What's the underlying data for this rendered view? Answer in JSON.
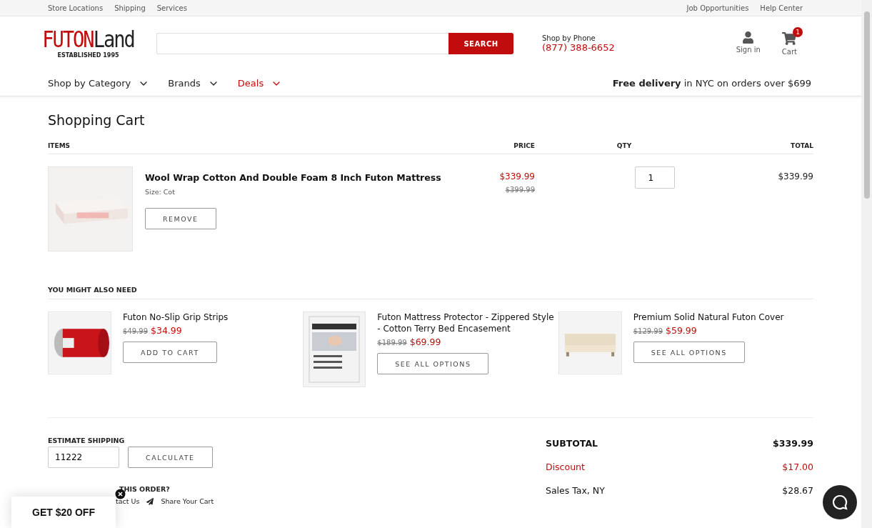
{
  "top_links_left": [
    "Store Locations",
    "Shipping",
    "Services"
  ],
  "top_links_right": [
    "Job Opportunities",
    "Help Center"
  ],
  "logo": {
    "brand_red": "FUTON",
    "brand_dark": "Land",
    "tagline": "ESTABLISHED 1995"
  },
  "search": {
    "button": "SEARCH"
  },
  "phone": {
    "label": "Shop by Phone",
    "number": "(877) 388-6652"
  },
  "account": {
    "label": "Sign in"
  },
  "cart_link": {
    "label": "Cart",
    "badge": "1"
  },
  "nav": [
    {
      "label": "Shop by Category",
      "highlight": false
    },
    {
      "label": "Brands",
      "highlight": false
    },
    {
      "label": "Deals",
      "highlight": true
    }
  ],
  "promo": "**Free delivery** in NYC on orders over $699",
  "page_title": "Shopping Cart",
  "table": {
    "columns": [
      "ITEMS",
      "PRICE",
      "QTY",
      "TOTAL"
    ],
    "rows": [
      {
        "name": "Wool Wrap Cotton And Double Foam 8 Inch Futon Mattress",
        "size_label": "Size:",
        "size": "Cot",
        "remove": "REMOVE",
        "price": "$339.99",
        "old_price": "$399.99",
        "qty": "1",
        "total": "$339.99"
      }
    ]
  },
  "recommendations": {
    "title": "YOU MIGHT ALSO NEED",
    "items": [
      {
        "name": "Futon No-Slip Grip Strips",
        "old_price": "$49.99",
        "price": "$34.99",
        "button": "ADD TO CART",
        "kind": "tape"
      },
      {
        "name": "Futon Mattress Protector - Zippered Style - Cotton Terry Bed Encasement",
        "old_price": "$189.99",
        "price": "$69.99",
        "button": "SEE ALL OPTIONS",
        "kind": "box"
      },
      {
        "name": "Premium Solid Natural Futon Cover",
        "old_price": "$129.99",
        "price": "$59.99",
        "button": "SEE ALL OPTIONS",
        "kind": "futon"
      }
    ]
  },
  "shipping": {
    "title": "ESTIMATE SHIPPING",
    "zip": "11222",
    "button": "CALCULATE",
    "question": "THIS ORDER?",
    "contact": "tact Us",
    "share": "Share Your Cart"
  },
  "summary": [
    {
      "label": "SUBTOTAL",
      "value": "$339.99",
      "kind": "total"
    },
    {
      "label": "Discount",
      "value": "$17.00",
      "kind": "discount"
    },
    {
      "label": "Sales Tax, NY",
      "value": "$28.67",
      "kind": "plain"
    }
  ],
  "popup": {
    "label": "GET $20 OFF"
  }
}
